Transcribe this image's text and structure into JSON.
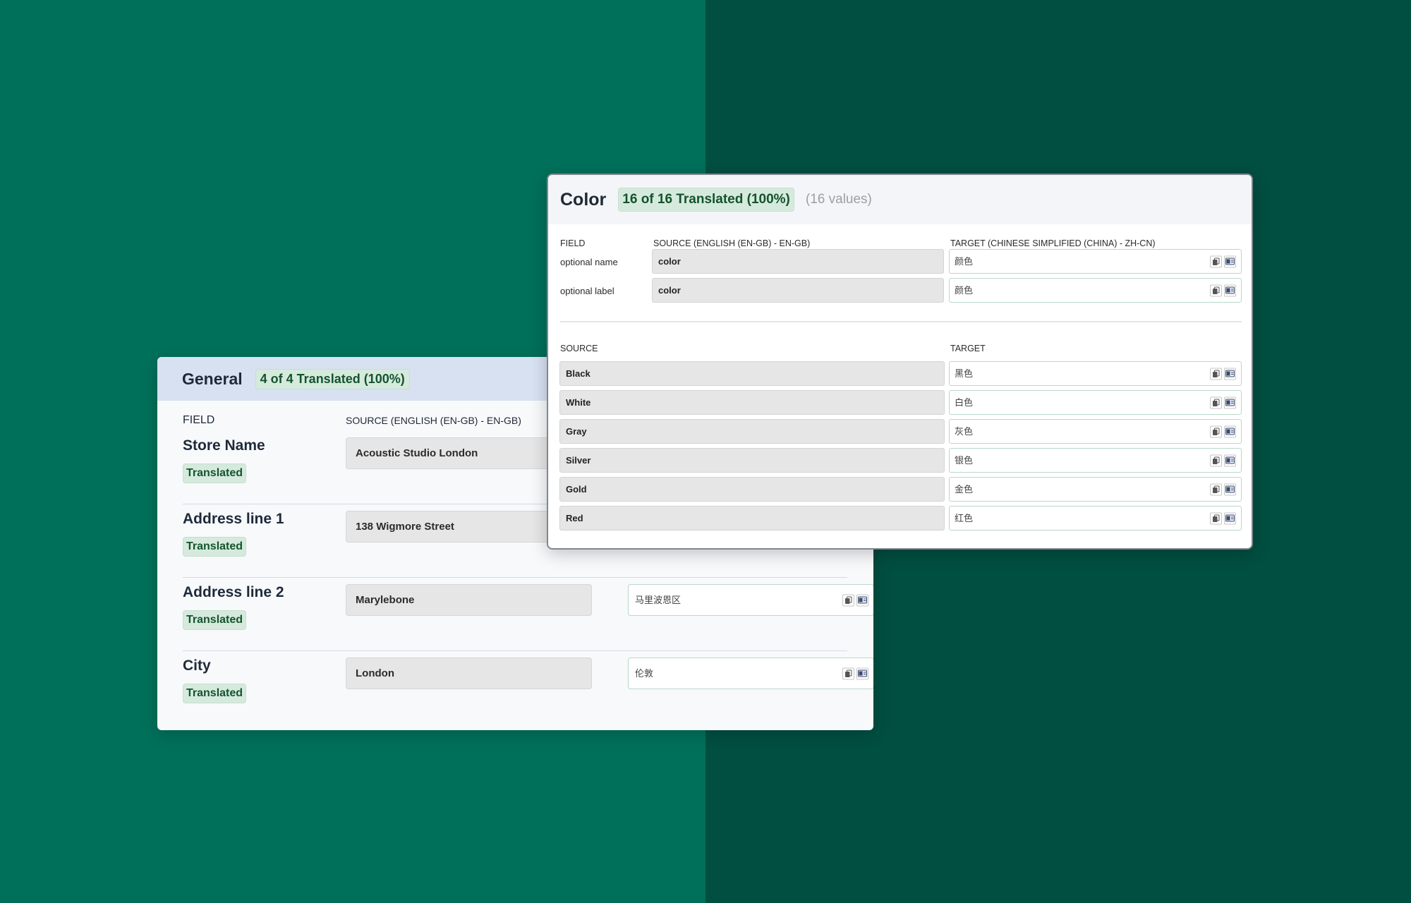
{
  "general": {
    "title": "General",
    "badge": "4 of 4 Translated (100%)",
    "field_header": "FIELD",
    "source_header": "SOURCE (ENGLISH (EN-GB) -  EN-GB)",
    "rows": [
      {
        "label": "Store Name",
        "status": "Translated",
        "source": "Acoustic Studio London",
        "target": ""
      },
      {
        "label": "Address line 1",
        "status": "Translated",
        "source": "138 Wigmore Street",
        "target": ""
      },
      {
        "label": "Address line 2",
        "status": "Translated",
        "source": "Marylebone",
        "target": "马里波恩区"
      },
      {
        "label": "City",
        "status": "Translated",
        "source": "London",
        "target": "伦敦"
      }
    ]
  },
  "color": {
    "title": "Color",
    "badge": "16 of 16 Translated (100%)",
    "count": "(16 values)",
    "field_header": "FIELD",
    "source_header": "SOURCE (ENGLISH (EN-GB) - EN-GB)",
    "target_header": "TARGET (CHINESE SIMPLIFIED (CHINA) - ZH-CN)",
    "fields": [
      {
        "label": "optional name",
        "source": "color",
        "target": "颜色"
      },
      {
        "label": "optional label",
        "source": "color",
        "target": "颜色"
      }
    ],
    "values_source_header": "SOURCE",
    "values_target_header": "TARGET",
    "values": [
      {
        "source": "Black",
        "target": "黑色"
      },
      {
        "source": "White",
        "target": "白色"
      },
      {
        "source": "Gray",
        "target": "灰色"
      },
      {
        "source": "Silver",
        "target": "银色"
      },
      {
        "source": "Gold",
        "target": "金色"
      },
      {
        "source": "Red",
        "target": "红色"
      }
    ]
  },
  "icons": {
    "copy": "copy-icon",
    "translate": "translate-icon"
  },
  "colors": {
    "bg_left": "#00705a",
    "bg_right": "#004f41",
    "badge_bg": "#d5eadd",
    "badge_text": "#14532d",
    "general_header_bg": "#d8e1f1",
    "target_border": "#b9d8cb"
  }
}
